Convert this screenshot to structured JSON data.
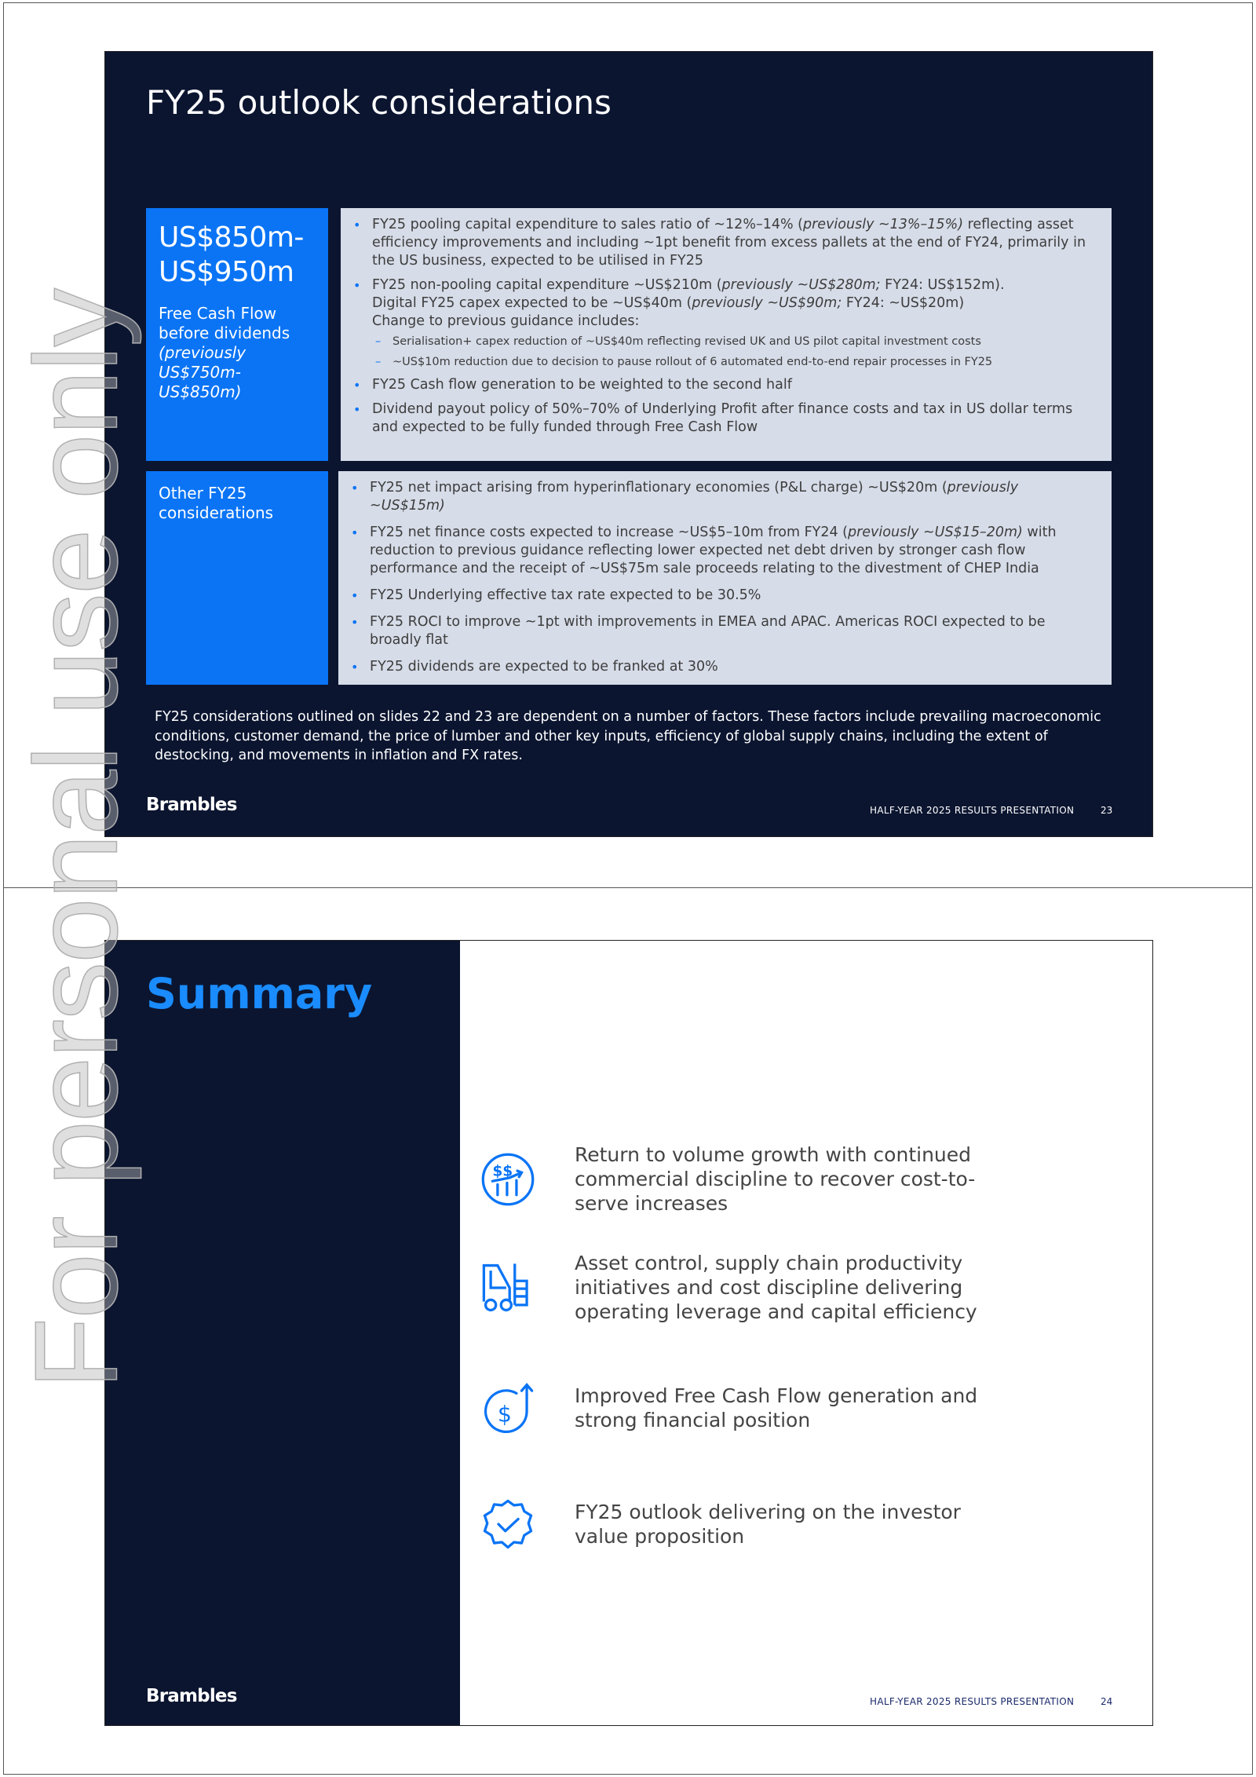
{
  "watermark": "For personal use only",
  "slide1": {
    "title": "FY25 outlook considerations",
    "fcf": {
      "amount": "US$850m- US$950m",
      "label": "Free Cash Flow before dividends",
      "previous": "(previously US$750m-US$850m)"
    },
    "fcf_bullets": [
      [
        {
          "t": "FY25 pooling capital expenditure to sales ratio of ~12%–14% ("
        },
        {
          "t": "previously ~13%–15%)",
          "i": true
        },
        {
          "t": " reflecting asset efficiency improvements and including ~1pt benefit from excess pallets at the end of FY24, primarily in the US business, expected to be utilised in FY25"
        }
      ],
      [
        {
          "t": "FY25 non-pooling capital expenditure ~US$210m ("
        },
        {
          "t": "previously ~US$280m;",
          "i": true
        },
        {
          "t": " FY24: US$152m)."
        }
      ],
      [
        {
          "t": "Digital FY25 capex expected to be ~US$40m ("
        },
        {
          "t": "previously ~US$90m;",
          "i": true
        },
        {
          "t": " FY24: ~US$20m)"
        }
      ],
      [
        {
          "t": "Change to previous guidance includes:"
        }
      ],
      [
        {
          "t": "FY25 Cash flow generation to be weighted to the second half"
        }
      ],
      [
        {
          "t": "Dividend payout policy of 50%–70% of Underlying Profit after finance costs and tax in US dollar terms and expected to be fully funded through Free Cash Flow"
        }
      ]
    ],
    "sub_bullets": [
      "Serialisation+ capex reduction of ~US$40m reflecting revised UK and US pilot capital investment costs",
      "~US$10m reduction due to decision to pause rollout of 6 automated end-to-end repair processes in FY25"
    ],
    "other_label": "Other FY25 considerations",
    "other_bullets": [
      [
        {
          "t": "FY25 net impact arising from hyperinflationary economies (P&L charge) ~US$20m ("
        },
        {
          "t": "previously ~US$15m)",
          "i": true
        }
      ],
      [
        {
          "t": "FY25 net finance costs expected to increase ~US$5–10m from FY24 ("
        },
        {
          "t": "previously ~US$15–20m)",
          "i": true
        },
        {
          "t": " with reduction to previous guidance reflecting lower expected net debt driven by stronger cash flow performance and the receipt of ~US$75m sale proceeds relating to the divestment of CHEP India"
        }
      ],
      [
        {
          "t": "FY25 Underlying effective tax rate expected to be 30.5%"
        }
      ],
      [
        {
          "t": "FY25 ROCI to improve ~1pt with improvements in EMEA and APAC. Americas ROCI expected to be broadly flat"
        }
      ],
      [
        {
          "t": "FY25 dividends are expected to be franked at 30%"
        }
      ]
    ],
    "note": "FY25 considerations outlined on slides 22 and 23 are dependent on a number of factors. These factors include prevailing macroeconomic conditions, customer demand, the price of lumber and other key inputs, efficiency of global supply chains, including the extent of destocking, and movements in inflation and FX rates.",
    "logo": "Brambles",
    "footer": "HALF-YEAR 2025 RESULTS PRESENTATION",
    "page": "23"
  },
  "slide2": {
    "title": "Summary",
    "items": [
      {
        "icon": "dollar-growth-chart-icon",
        "text": "Return to volume growth with continued commercial discipline to recover cost-to-serve increases"
      },
      {
        "icon": "forklift-icon",
        "text": "Asset control, supply chain productivity initiatives and cost discipline delivering operating leverage and capital efficiency"
      },
      {
        "icon": "dollar-cycle-arrow-icon",
        "text": "Improved Free Cash Flow generation and strong financial position"
      },
      {
        "icon": "badge-check-icon",
        "text": "FY25 outlook delivering on the investor value proposition"
      }
    ],
    "logo": "Brambles",
    "footer": "HALF-YEAR 2025 RESULTS PRESENTATION",
    "page": "24"
  },
  "colors": {
    "navy": "#0b1530",
    "blue": "#0a74f5",
    "grey_box": "#d6dce8",
    "summary_title": "#1a8cff"
  }
}
